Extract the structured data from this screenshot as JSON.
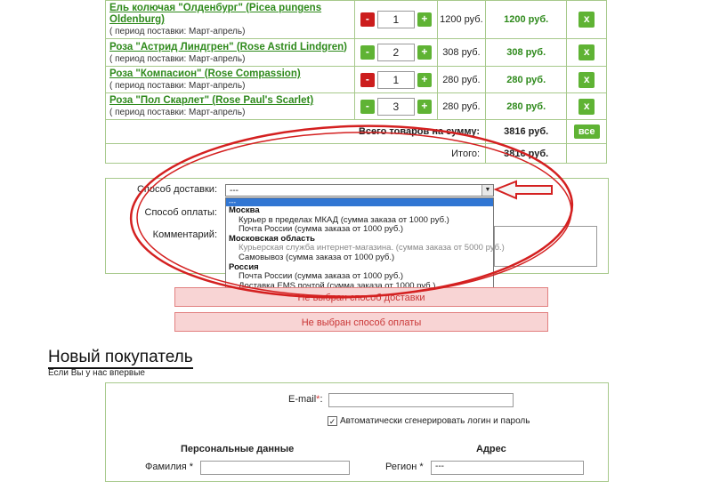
{
  "cart": {
    "items": [
      {
        "name": "Ель колючая \"Олденбург\" (Picea pungens Oldenburg)",
        "period": "( период поставки: Март-апрель)",
        "qty": "1",
        "minus_active": true,
        "price": "1200 руб.",
        "total": "1200 руб.",
        "delete": "x"
      },
      {
        "name": "Роза \"Астрид Линдгрен\" (Rose Astrid Lindgren)",
        "period": "( период поставки: Март-апрель)",
        "qty": "2",
        "minus_active": false,
        "price": "308 руб.",
        "total": "308 руб.",
        "delete": "x"
      },
      {
        "name": "Роза \"Компасион\" (Rose Compassion)",
        "period": "( период поставки: Март-апрель)",
        "qty": "1",
        "minus_active": true,
        "price": "280 руб.",
        "total": "280 руб.",
        "delete": "x"
      },
      {
        "name": "Роза \"Пол Скарлет\" (Rose Paul's Scarlet)",
        "period": "( период поставки: Март-апрель)",
        "qty": "3",
        "minus_active": false,
        "price": "280 руб.",
        "total": "280 руб.",
        "delete": "x"
      }
    ],
    "minus": "-",
    "plus": "+",
    "sum_label": "Всего товаров на сумму:",
    "sum_value": "3816 руб.",
    "clear_all": "все",
    "total_label": "Итого:",
    "total_value": "3816 руб."
  },
  "order": {
    "delivery_label": "Способ доставки:",
    "delivery_value": "---",
    "payment_label": "Способ оплаты:",
    "comment_label": "Комментарий:",
    "dropdown": {
      "selected": "---",
      "groups": [
        {
          "label": "Москва",
          "options": [
            {
              "text": "Курьер в пределах МКАД (сумма заказа от 1000 руб.)",
              "disabled": false
            },
            {
              "text": "Почта России (сумма заказа от 1000 руб.)",
              "disabled": false
            }
          ]
        },
        {
          "label": "Московская область",
          "options": [
            {
              "text": "Курьерская служба интернет-магазина. (сумма заказа от 5000 руб.)",
              "disabled": true
            },
            {
              "text": "Самовывоз (сумма заказа от 1000 руб.)",
              "disabled": false
            }
          ]
        },
        {
          "label": "Россия",
          "options": [
            {
              "text": "Почта России (сумма заказа от 1000 руб.)",
              "disabled": false
            },
            {
              "text": "Доставка EMS почтой (сумма заказа от 1000 руб.)",
              "disabled": false
            }
          ]
        }
      ]
    },
    "error_delivery": "Не выбран способ доставки",
    "error_payment": "Не выбран способ оплаты"
  },
  "new_customer": {
    "title": "Новый покупатель",
    "subtitle": "Если Вы у нас впервые",
    "email_label": "E-mail",
    "required_mark": "*",
    "email_colon": ":",
    "autogen_label": "Автоматически сгенерировать логин и пароль",
    "autogen_checked": "✓",
    "personal_header": "Персональные данные",
    "address_header": "Адрес",
    "lastname_label": "Фамилия *",
    "region_label": "Регион *",
    "region_value": "---"
  },
  "colors": {
    "accent_green": "#5fb334",
    "link_green": "#2f8a1c",
    "error_bg": "#f8d4d4",
    "annotation_red": "#d42020"
  }
}
